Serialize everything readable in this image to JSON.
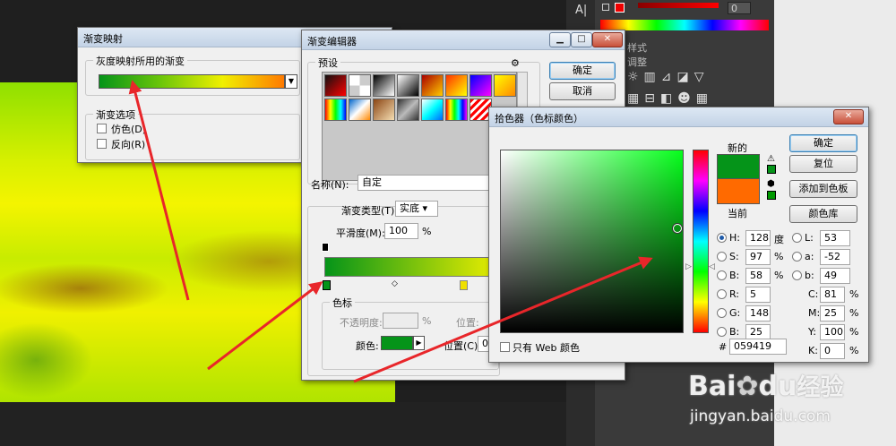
{
  "panel": {
    "char_tool": "A|",
    "opacity_value": "0",
    "style_tab": "样式",
    "adjust_tab": "调整"
  },
  "gradient_map": {
    "title": "渐变映射",
    "group_label": "灰度映射所用的渐变",
    "options_label": "渐变选项",
    "dither": "仿色(D)",
    "reverse": "反向(R)",
    "gradient": "linear-gradient(90deg,#059419,#6cc60a,#f0f000,#ff7a00)"
  },
  "gradient_editor": {
    "title": "渐变编辑器",
    "presets_label": "预设",
    "ok": "确定",
    "cancel": "取消",
    "name_label": "名称(N):",
    "name_value": "自定",
    "type_label": "渐变类型(T):",
    "type_value": "实底",
    "smooth_label": "平滑度(M):",
    "smooth_value": "100",
    "percent": "%",
    "stops_label": "色标",
    "opacity_label": "不透明度:",
    "position_label": "位置:",
    "color_label": "颜色:",
    "position2_label": "位置(C):",
    "position2_value": "0",
    "color_value": "#059419",
    "presets": [
      "linear-gradient(135deg,#111,#f00)",
      "repeating-conic-gradient(#ccc 0 25%,#fff 0 50%)",
      "linear-gradient(135deg,#000,#fff)",
      "linear-gradient(135deg,#fff,#000)",
      "linear-gradient(135deg,#a00,#fc0)",
      "linear-gradient(135deg,#f30,#ff0)",
      "linear-gradient(135deg,#00f,#f0f)",
      "linear-gradient(135deg,#ff0,#f80)",
      "linear-gradient(90deg,red,yellow,lime,cyan,blue)",
      "linear-gradient(135deg,#06c,#fff,#f80)",
      "linear-gradient(135deg,#8b4513,#f5deb3)",
      "linear-gradient(135deg,#333,#bbb,#333)",
      "linear-gradient(135deg,#fff,#0ff,#06f)",
      "linear-gradient(90deg,#f00,#ff0,#0f0,#0ff,#00f,#f0f)",
      "repeating-linear-gradient(135deg,#f00 0 3px,#fff 3px 6px)"
    ]
  },
  "color_picker": {
    "title": "拾色器（色标颜色）",
    "new_label": "新的",
    "current_label": "当前",
    "new_color": "#059419",
    "current_color": "#ff6a00",
    "ok": "确定",
    "reset": "复位",
    "add_swatch": "添加到色板",
    "library": "颜色库",
    "web_only": "只有 Web 颜色",
    "h_label": "H:",
    "h_value": "128",
    "h_unit": "度",
    "s_label": "S:",
    "s_value": "97",
    "s_unit": "%",
    "b_label": "B:",
    "b_value": "58",
    "b_unit": "%",
    "r_label": "R:",
    "r_value": "5",
    "g_label": "G:",
    "g_value": "148",
    "bb_label": "B:",
    "bb_value": "25",
    "l_label": "L:",
    "l_value": "53",
    "a_label": "a:",
    "a_value": "-52",
    "lb_label": "b:",
    "lb_value": "49",
    "c_label": "C:",
    "c_value": "81",
    "m_label": "M:",
    "m_value": "25",
    "y_label": "Y:",
    "y_value": "100",
    "k_label": "K:",
    "k_value": "0",
    "hex_label": "#",
    "hex_value": "059419",
    "pct": "%"
  },
  "watermark": {
    "brand_a": "Bai",
    "brand_b": "du",
    "brand_cn": "经验",
    "url": "jingyan.baidu.com"
  }
}
